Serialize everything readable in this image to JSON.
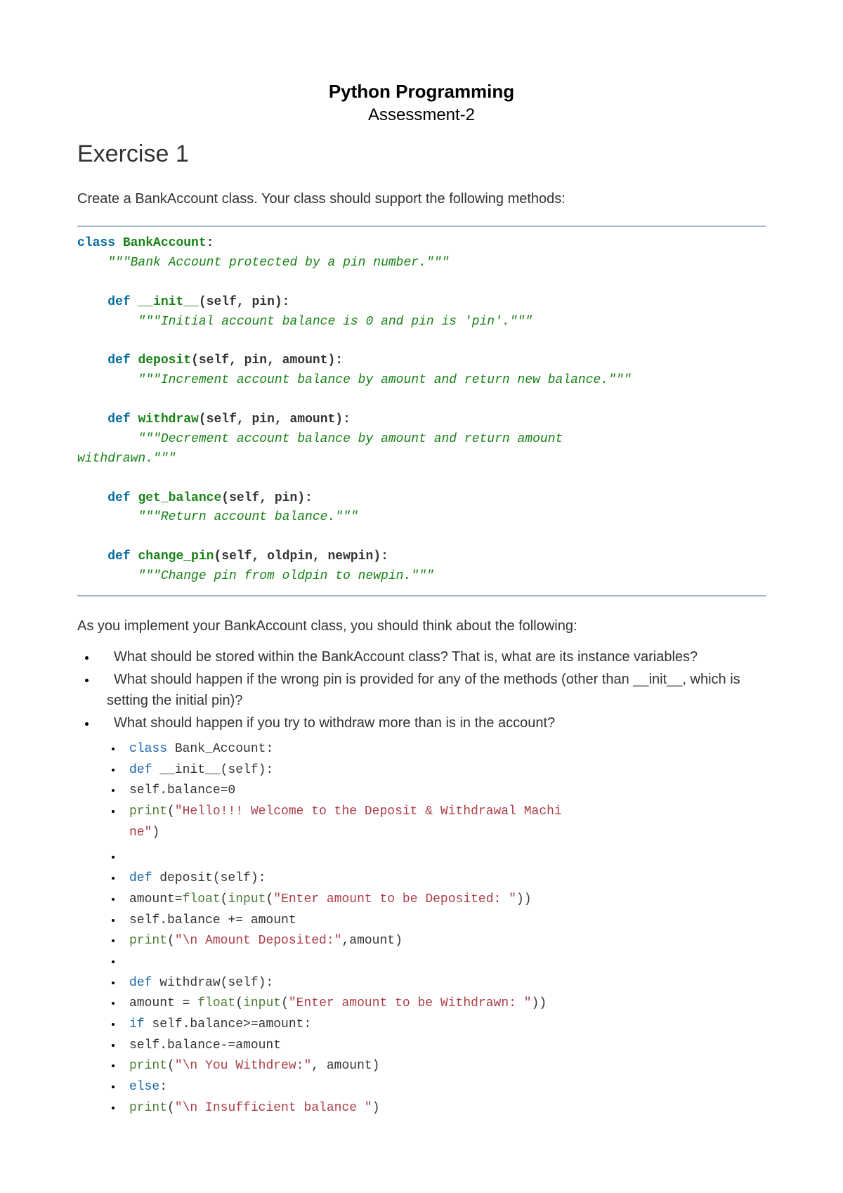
{
  "header": {
    "title": "Python Programming",
    "subtitle": "Assessment-2"
  },
  "exercise": {
    "heading": "Exercise 1",
    "intro": "Create a BankAccount class. Your class should support the following methods:",
    "codeblock": {
      "class_kw": "class",
      "class_name": "BankAccount",
      "class_doc": "\"\"\"Bank Account protected by a pin number.\"\"\"",
      "def_kw": "def",
      "init_name": "__init__",
      "init_params": "(self, pin):",
      "init_doc": "\"\"\"Initial account balance is 0 and pin is 'pin'.\"\"\"",
      "deposit_name": "deposit",
      "deposit_params": "(self, pin, amount):",
      "deposit_doc": "\"\"\"Increment account balance by amount and return new balance.\"\"\"",
      "withdraw_name": "withdraw",
      "withdraw_params": "(self, pin, amount):",
      "withdraw_doc_a": "\"\"\"Decrement account balance by amount and return amount ",
      "withdraw_doc_b": "withdrawn.\"\"\"",
      "getbal_name": "get_balance",
      "getbal_params": "(self, pin):",
      "getbal_doc": "\"\"\"Return account balance.\"\"\"",
      "changepin_name": "change_pin",
      "changepin_params": "(self, oldpin, newpin):",
      "changepin_doc": "\"\"\"Change pin from oldpin to newpin.\"\"\""
    },
    "followup": "As you implement your BankAccount class, you should think about the following:",
    "questions": [
      "What should be stored within the BankAccount class? That is, what are its instance variables?",
      "What should happen if the wrong pin is provided for any of the methods (other than __init__, which is setting the initial pin)?",
      "What should happen if you try to withdraw more than is in the account?"
    ],
    "solution": {
      "l0_a": "class",
      "l0_b": " Bank_Account:",
      "l1_a": "    def",
      "l1_b": " __init__",
      "l1_c": "(self):",
      "l2": "        self.balance=0",
      "l3_a": "        print",
      "l3_b": "(",
      "l3_c": "\"Hello!!! Welcome to the Deposit & Withdrawal Machi",
      "l3_d": "ne\"",
      "l3_e": ")",
      "l4": " ",
      "l5_a": "    def",
      "l5_b": " deposit",
      "l5_c": "(self):",
      "l6_a": "        amount=",
      "l6_b": "float",
      "l6_c": "(",
      "l6_d": "input",
      "l6_e": "(",
      "l6_f": "\"Enter amount to be Deposited: \"",
      "l6_g": "))",
      "l7": "        self.balance += amount",
      "l8_a": "        print",
      "l8_b": "(",
      "l8_c": "\"\\n Amount Deposited:\"",
      "l8_d": ",amount)",
      "l9": " ",
      "l10_a": "    def",
      "l10_b": " withdraw",
      "l10_c": "(self):",
      "l11_a": "        amount = ",
      "l11_b": "float",
      "l11_c": "(",
      "l11_d": "input",
      "l11_e": "(",
      "l11_f": "\"Enter amount to be Withdrawn: \"",
      "l11_g": "))",
      "l12_a": "        if",
      "l12_b": " self.balance>=amount:",
      "l13": "            self.balance-=amount",
      "l14_a": "            print",
      "l14_b": "(",
      "l14_c": "\"\\n You Withdrew:\"",
      "l14_d": ", amount)",
      "l15_a": "        else",
      "l15_b": ":",
      "l16_a": "            print",
      "l16_b": "(",
      "l16_c": "\"\\n Insufficient balance  \"",
      "l16_d": ")"
    }
  }
}
